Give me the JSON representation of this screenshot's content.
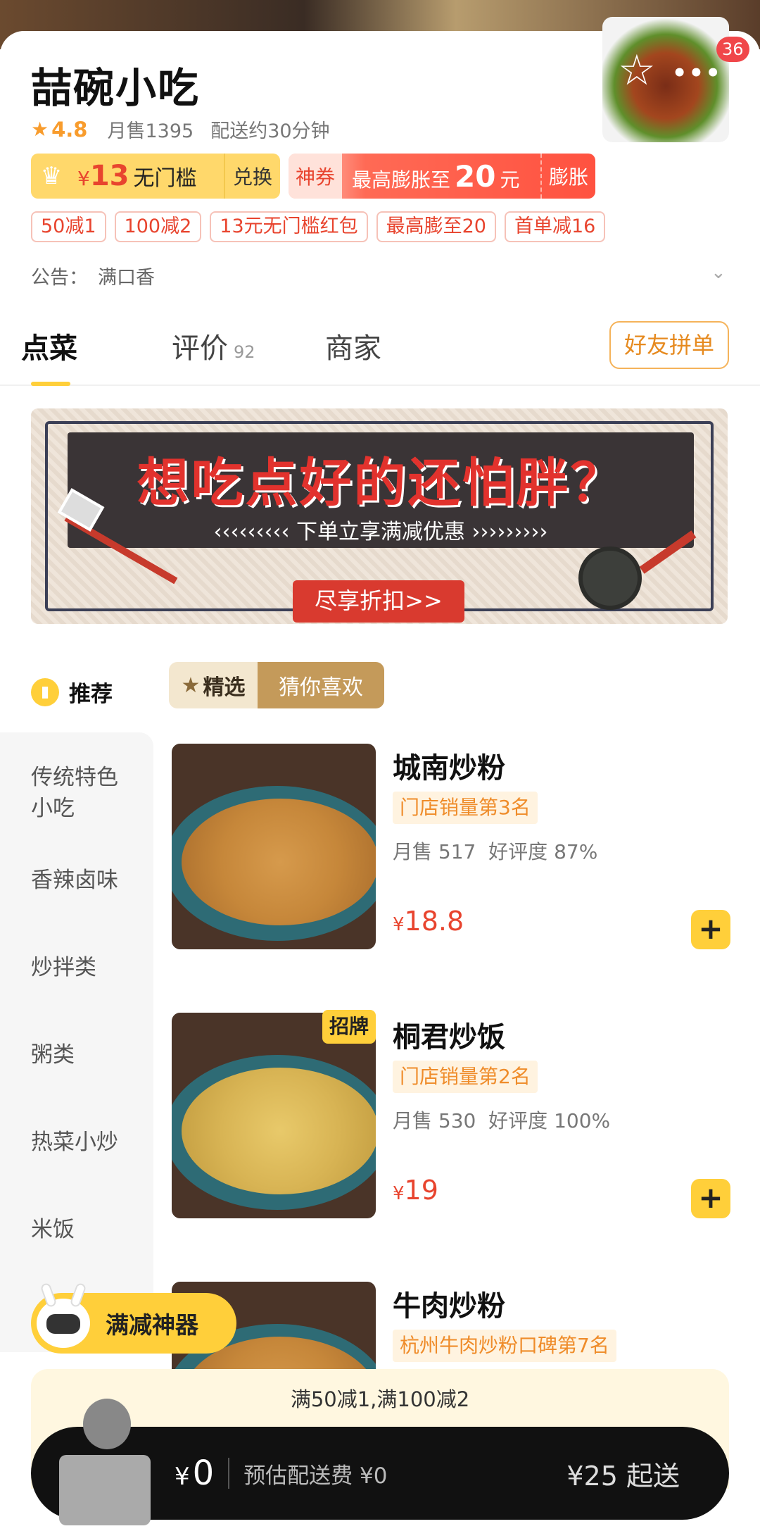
{
  "store": {
    "title": "喆碗小吃",
    "rating": "4.8",
    "monthly_sales": "月售1395",
    "delivery_time": "配送约30分钟",
    "image_badge_count": "36",
    "notice_label": "公告：",
    "notice_text": "满口香"
  },
  "vip_card": {
    "currency": "¥",
    "amount": "13",
    "label": "无门槛",
    "exchange": "兑换"
  },
  "super_coupon": {
    "tag": "神券",
    "prefix": "最高膨胀至",
    "amount": "20",
    "unit": "元",
    "expand": "膨胀"
  },
  "discount_tags": [
    "50减1",
    "100减2",
    "13元无门槛红包",
    "最高膨至20",
    "首单减16"
  ],
  "tabs": {
    "order": "点菜",
    "reviews": "评价",
    "reviews_count": "92",
    "merchant": "商家",
    "group_order": "好友拼单"
  },
  "banner": {
    "headline": "想吃点好的还怕胖？",
    "subline": "‹‹‹‹‹‹‹‹‹  下单立享满减优惠  ›››››››››",
    "button": "尽享折扣>>"
  },
  "menu": {
    "recommend_label": "推荐",
    "filter_selected": "精选",
    "filter_other": "猜你喜欢",
    "categories": [
      {
        "line1": "传统特色",
        "line2": "小吃"
      },
      {
        "line1": "香辣卤味",
        "line2": ""
      },
      {
        "line1": "炒拌类",
        "line2": ""
      },
      {
        "line1": "粥类",
        "line2": ""
      },
      {
        "line1": "热菜小炒",
        "line2": ""
      },
      {
        "line1": "米饭",
        "line2": ""
      }
    ],
    "dishes": [
      {
        "name": "城南炒粉",
        "rank": "门店销量第3名",
        "sales": "月售 517",
        "rating": "好评度 87%",
        "price_symbol": "¥",
        "price": "18.8",
        "badge": ""
      },
      {
        "name": "桐君炒饭",
        "rank": "门店销量第2名",
        "sales": "月售 530",
        "rating": "好评度 100%",
        "price_symbol": "¥",
        "price": "19",
        "badge": "招牌"
      },
      {
        "name": "牛肉炒粉",
        "rank": "杭州牛肉炒粉口碑第7名",
        "sales": "",
        "rating": "",
        "price_symbol": "",
        "price": "",
        "badge": ""
      }
    ]
  },
  "discount_tool": {
    "label": "满减神器"
  },
  "promo_message": "满50减1,满100减2",
  "cart": {
    "currency": "¥",
    "total": "0",
    "delivery_fee": "预估配送费 ¥0",
    "min_order": "¥25 起送"
  },
  "colors": {
    "accent_yellow": "#ffcf3a",
    "price_red": "#e8442e",
    "rank_orange": "#ef8c2a"
  }
}
